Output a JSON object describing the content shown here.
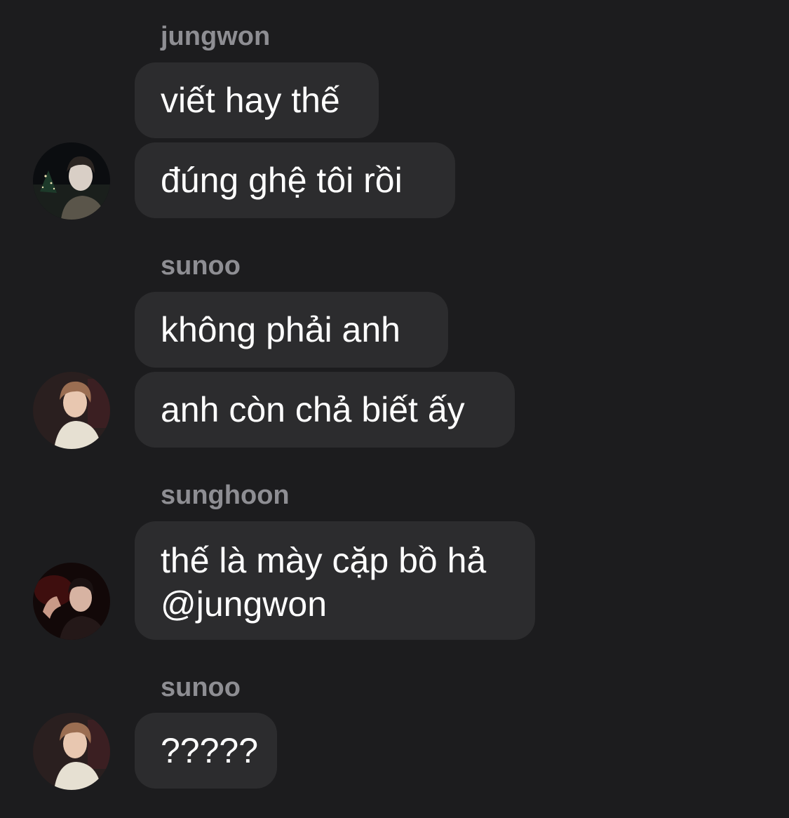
{
  "colors": {
    "background": "#1c1c1e",
    "bubble": "#2c2c2e",
    "sender_name": "#8e8e93",
    "message_text": "#ffffff"
  },
  "groups": [
    {
      "sender": "jungwon",
      "avatar": "jungwon-avatar",
      "messages": [
        "viết hay thế",
        "đúng ghệ tôi rồi"
      ]
    },
    {
      "sender": "sunoo",
      "avatar": "sunoo-avatar",
      "messages": [
        "không phải anh",
        "anh còn chả biết ấy"
      ]
    },
    {
      "sender": "sunghoon",
      "avatar": "sunghoon-avatar",
      "messages": [
        "thế là mày cặp bồ hả @jungwon"
      ]
    },
    {
      "sender": "sunoo",
      "avatar": "sunoo-avatar",
      "messages": [
        "?????"
      ]
    }
  ]
}
